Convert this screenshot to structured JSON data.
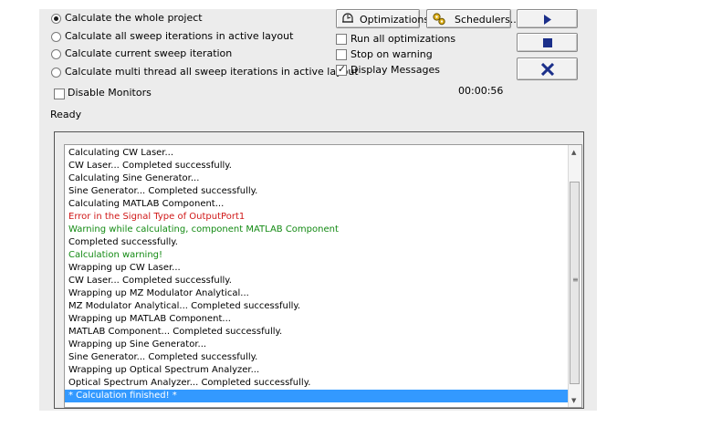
{
  "options": {
    "radios": [
      {
        "label": "Calculate the whole project",
        "selected": true
      },
      {
        "label": "Calculate all sweep iterations in active layout",
        "selected": false
      },
      {
        "label": "Calculate current sweep iteration",
        "selected": false
      },
      {
        "label": "Calculate multi thread all sweep iterations in active layout",
        "selected": false
      }
    ],
    "disable_monitors": {
      "label": "Disable Monitors",
      "checked": false
    }
  },
  "toolbar": {
    "optimizations_label": "Optimizations",
    "schedulers_label": "Schedulers...",
    "run_icon": "play-icon",
    "stop_icon": "stop-icon",
    "cancel_icon": "close-icon"
  },
  "checks": [
    {
      "label": "Run all optimizations",
      "checked": false
    },
    {
      "label": "Stop on warning",
      "checked": false
    },
    {
      "label": "Display Messages",
      "checked": true
    }
  ],
  "status": {
    "elapsed": "00:00:56",
    "state": "Ready"
  },
  "colors": {
    "error": "#d01818",
    "warning": "#138a13",
    "selection": "#3399ff",
    "play": "#1b2f8a"
  },
  "log": {
    "lines": [
      {
        "text": "Calculating CW Laser...",
        "type": "normal"
      },
      {
        "text": "CW Laser... Completed successfully.",
        "type": "normal"
      },
      {
        "text": "Calculating Sine Generator...",
        "type": "normal"
      },
      {
        "text": "Sine Generator... Completed successfully.",
        "type": "normal"
      },
      {
        "text": "Calculating MATLAB Component...",
        "type": "normal"
      },
      {
        "text": "Error in the Signal Type of OutputPort1",
        "type": "error"
      },
      {
        "text": "Warning  while calculating, component  MATLAB Component",
        "type": "warning"
      },
      {
        "text": "Completed successfully.",
        "type": "normal"
      },
      {
        "text": "Calculation warning!",
        "type": "warning"
      },
      {
        "text": "Wrapping up CW Laser...",
        "type": "normal"
      },
      {
        "text": "CW Laser... Completed successfully.",
        "type": "normal"
      },
      {
        "text": "Wrapping up MZ Modulator Analytical...",
        "type": "normal"
      },
      {
        "text": "MZ Modulator Analytical... Completed successfully.",
        "type": "normal"
      },
      {
        "text": "Wrapping up MATLAB Component...",
        "type": "normal"
      },
      {
        "text": "MATLAB Component... Completed successfully.",
        "type": "normal"
      },
      {
        "text": "Wrapping up Sine Generator...",
        "type": "normal"
      },
      {
        "text": "Sine Generator... Completed successfully.",
        "type": "normal"
      },
      {
        "text": "Wrapping up Optical Spectrum Analyzer...",
        "type": "normal"
      },
      {
        "text": "Optical Spectrum Analyzer... Completed successfully.",
        "type": "normal"
      },
      {
        "text": "* Calculation finished! *",
        "type": "selected"
      }
    ]
  }
}
